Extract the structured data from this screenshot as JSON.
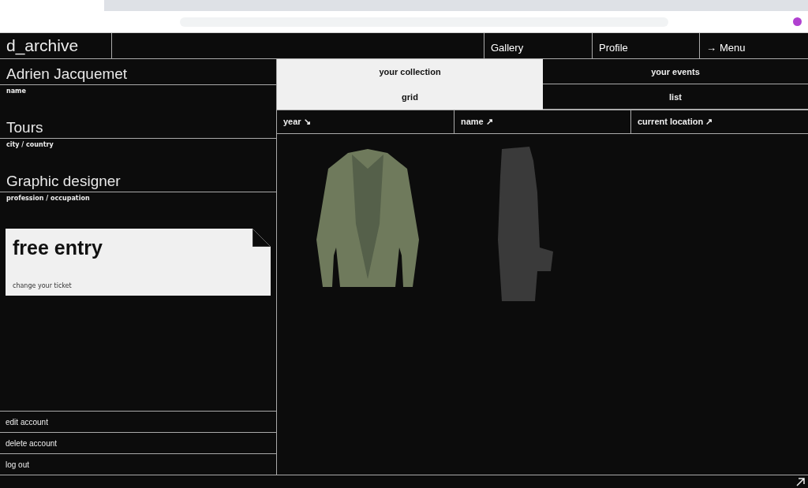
{
  "header": {
    "logo": "d_archive",
    "nav": [
      {
        "label": "Gallery"
      },
      {
        "label": "Profile"
      },
      {
        "label": "Menu",
        "icon": "→"
      }
    ]
  },
  "profile": {
    "fields": [
      {
        "value": "Adrien Jacquemet",
        "label": "name"
      },
      {
        "value": "Tours",
        "label": "city / country"
      },
      {
        "value": "Graphic designer",
        "label": "profession / occupation"
      }
    ],
    "ticket": {
      "title": "free entry",
      "link": "change your ticket"
    },
    "actions": [
      "edit account",
      "delete account",
      "log out"
    ]
  },
  "tabs": [
    {
      "label": "your collection",
      "selected": true
    },
    {
      "label": "your events",
      "selected": false
    }
  ],
  "views": [
    {
      "label": "grid",
      "selected": true
    },
    {
      "label": "list",
      "selected": false
    }
  ],
  "sort_columns": [
    {
      "label": "year",
      "arrow": "↘"
    },
    {
      "label": "name",
      "arrow": "↗"
    },
    {
      "label": "current location",
      "arrow": "↗"
    }
  ],
  "items": [
    {
      "kind": "jacket"
    },
    {
      "kind": "garment"
    }
  ]
}
